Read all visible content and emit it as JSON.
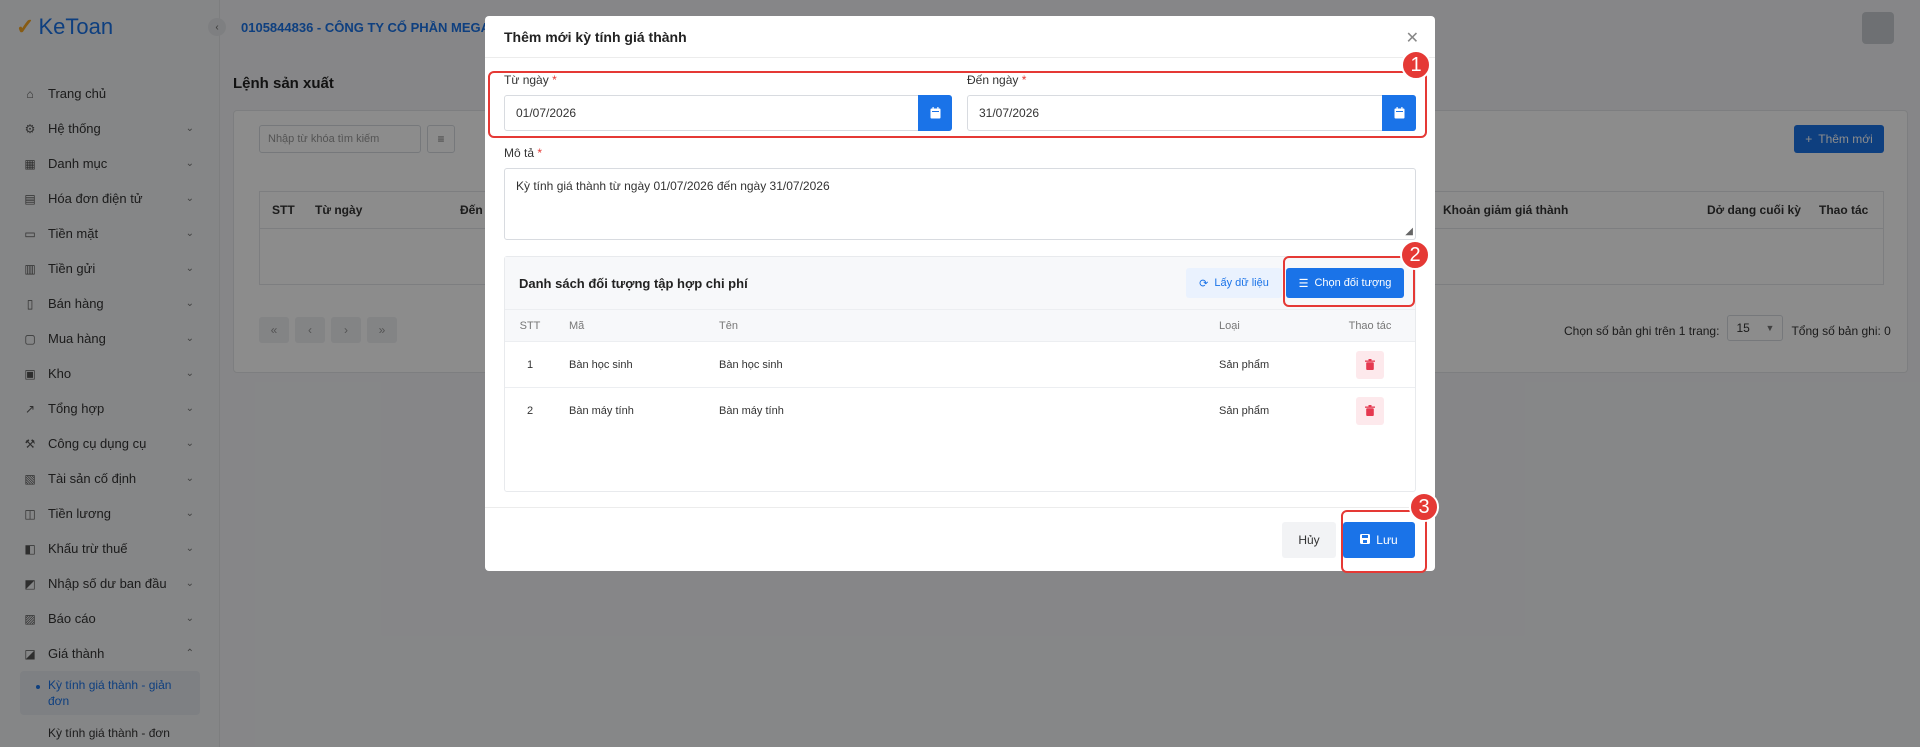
{
  "app": {
    "logo": "KeToan",
    "company": "0105844836 - CÔNG TY CỔ PHẦN MEGA"
  },
  "sidebar": {
    "items": [
      {
        "label": "Trang chủ",
        "icon": "home-icon",
        "chevron": ""
      },
      {
        "label": "Hệ thống",
        "icon": "gear-icon",
        "chevron": "⌄"
      },
      {
        "label": "Danh mục",
        "icon": "grid-icon",
        "chevron": "⌄"
      },
      {
        "label": "Hóa đơn điện tử",
        "icon": "invoice-icon",
        "chevron": "⌄"
      },
      {
        "label": "Tiền mặt",
        "icon": "cash-icon",
        "chevron": "⌄"
      },
      {
        "label": "Tiền gửi",
        "icon": "bank-icon",
        "chevron": "⌄"
      },
      {
        "label": "Bán hàng",
        "icon": "sales-icon",
        "chevron": "⌄"
      },
      {
        "label": "Mua hàng",
        "icon": "cart-icon",
        "chevron": "⌄"
      },
      {
        "label": "Kho",
        "icon": "warehouse-icon",
        "chevron": "⌄"
      },
      {
        "label": "Tổng hợp",
        "icon": "chart-icon",
        "chevron": "⌄"
      },
      {
        "label": "Công cụ dụng cụ",
        "icon": "tool-icon",
        "chevron": "⌄"
      },
      {
        "label": "Tài sản cố định",
        "icon": "asset-icon",
        "chevron": "⌄"
      },
      {
        "label": "Tiền lương",
        "icon": "salary-icon",
        "chevron": "⌄"
      },
      {
        "label": "Khấu trừ thuế",
        "icon": "tax-icon",
        "chevron": "⌄"
      },
      {
        "label": "Nhập số dư ban đầu",
        "icon": "balance-icon",
        "chevron": "⌄"
      },
      {
        "label": "Báo cáo",
        "icon": "report-icon",
        "chevron": "⌄"
      },
      {
        "label": "Giá thành",
        "icon": "cost-icon",
        "chevron": "⌃"
      }
    ],
    "sub_active": "Kỳ tính giá thành - giản đơn",
    "sub_next": "Kỳ tính giá thành - đơn"
  },
  "page": {
    "title": "Lệnh sản xuất",
    "search_placeholder": "Nhập từ khóa tìm kiếm",
    "add_button": "Thêm mới",
    "columns": [
      "STT",
      "Từ ngày",
      "Đến",
      "Khoản giảm giá thành",
      "Dở dang cuối kỳ",
      "Thao tác"
    ],
    "pager_label": "Chọn số bản ghi trên 1 trang:",
    "page_size": "15",
    "total_label": "Tổng số bản ghi: 0"
  },
  "modal": {
    "title": "Thêm mới kỳ tính giá thành",
    "from_label": "Từ ngày",
    "from_value": "01/07/2026",
    "to_label": "Đến ngày",
    "to_value": "31/07/2026",
    "desc_label": "Mô tả",
    "desc_value": "Kỳ tính giá thành từ ngày 01/07/2026 đến ngày 31/07/2026",
    "required_mark": "*",
    "list_title": "Danh sách đối tượng tập hợp chi phí",
    "load_button": "Lấy dữ liệu",
    "choose_button": "Chọn đối tượng",
    "list_columns": {
      "stt": "STT",
      "ma": "Mã",
      "ten": "Tên",
      "loai": "Loại",
      "thaotac": "Thao tác"
    },
    "rows": [
      {
        "stt": "1",
        "ma": "Bàn học sinh",
        "ten": "Bàn học sinh",
        "loai": "Sản phẩm"
      },
      {
        "stt": "2",
        "ma": "Bàn máy tính",
        "ten": "Bàn máy tính",
        "loai": "Sản phẩm"
      }
    ],
    "cancel_button": "Hủy",
    "save_button": "Lưu"
  },
  "annotations": [
    "1",
    "2",
    "3"
  ],
  "colors": {
    "primary": "#1a73e8",
    "highlight": "#e53935",
    "danger": "#e53950"
  }
}
